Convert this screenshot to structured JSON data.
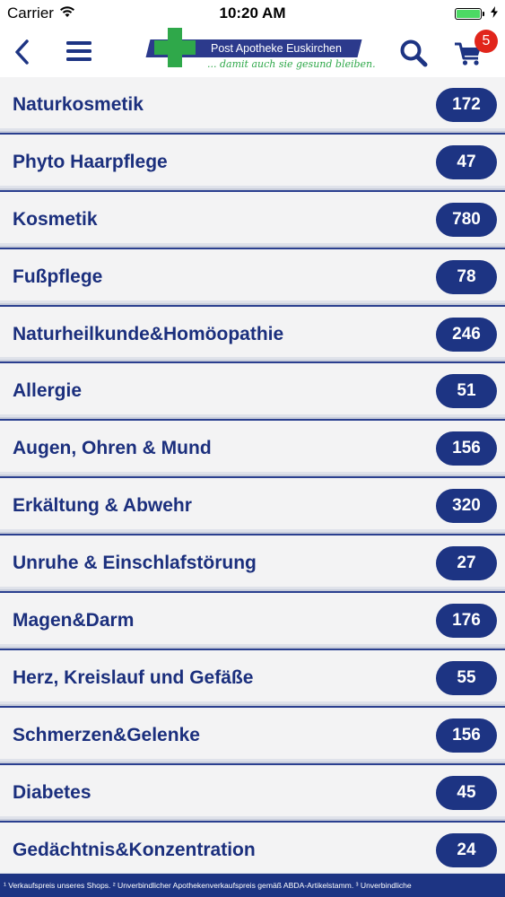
{
  "status_bar": {
    "carrier": "Carrier",
    "time": "10:20 AM",
    "wifi_icon": "wifi-icon",
    "battery_icon": "battery-icon",
    "charging_icon": "charging-bolt-icon"
  },
  "header": {
    "back_icon": "chevron-left-icon",
    "menu_icon": "hamburger-menu-icon",
    "logo": {
      "title": "Post Apotheke Euskirchen",
      "slogan": "... damit auch sie gesund bleiben."
    },
    "search_icon": "search-icon",
    "cart_icon": "shopping-cart-icon",
    "cart_count": "5"
  },
  "categories": [
    {
      "label": "Naturkosmetik",
      "count": "172"
    },
    {
      "label": "Phyto Haarpflege",
      "count": "47"
    },
    {
      "label": "Kosmetik",
      "count": "780"
    },
    {
      "label": "Fußpflege",
      "count": "78"
    },
    {
      "label": "Naturheilkunde&Homöopathie",
      "count": "246"
    },
    {
      "label": "Allergie",
      "count": "51"
    },
    {
      "label": "Augen, Ohren & Mund",
      "count": "156"
    },
    {
      "label": "Erkältung & Abwehr",
      "count": "320"
    },
    {
      "label": "Unruhe & Einschlafstörung",
      "count": "27"
    },
    {
      "label": "Magen&Darm",
      "count": "176"
    },
    {
      "label": "Herz, Kreislauf und Gefäße",
      "count": "55"
    },
    {
      "label": "Schmerzen&Gelenke",
      "count": "156"
    },
    {
      "label": "Diabetes",
      "count": "45"
    },
    {
      "label": "Gedächtnis&Konzentration",
      "count": "24"
    }
  ],
  "footer": {
    "text": "¹ Verkaufspreis unseres Shops. ² Unverbindlicher Apothekenverkaufspreis gemäß ABDA-Artikelstamm. ³ Unverbindliche"
  },
  "colors": {
    "brand_blue": "#1d3483",
    "brand_green": "#2fa84a",
    "badge_red": "#e1251b"
  }
}
